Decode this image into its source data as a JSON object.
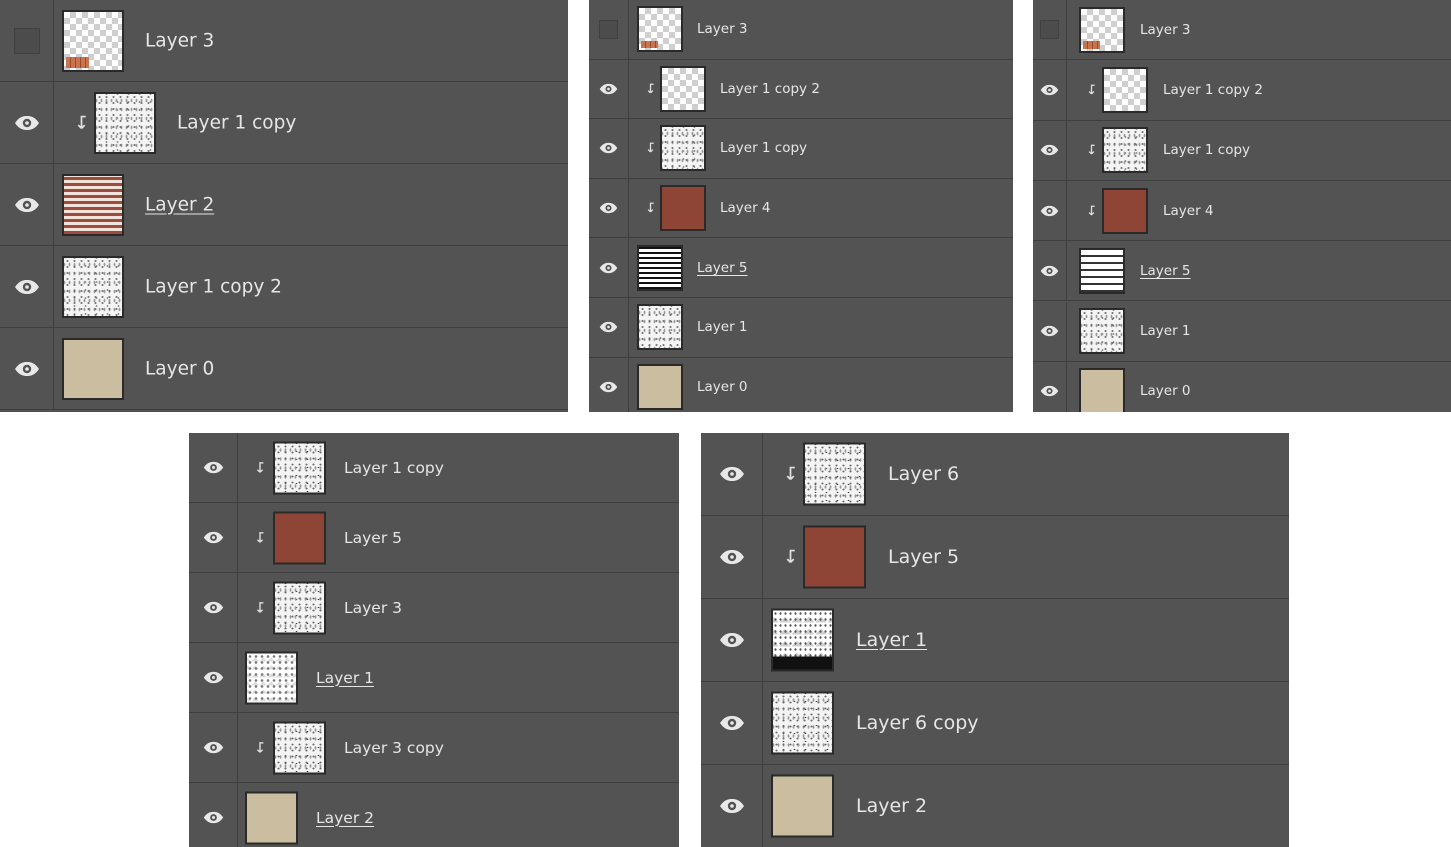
{
  "panels": [
    {
      "layers": [
        {
          "name": "Layer 3",
          "visible": false,
          "clipped": false,
          "thumb": "checker-brick",
          "underlined": false
        },
        {
          "name": "Layer 1 copy",
          "visible": true,
          "clipped": true,
          "thumb": "noise",
          "underlined": false
        },
        {
          "name": "Layer 2",
          "visible": true,
          "clipped": false,
          "thumb": "brick",
          "underlined": true
        },
        {
          "name": "Layer 1 copy 2",
          "visible": true,
          "clipped": false,
          "thumb": "noise",
          "underlined": false
        },
        {
          "name": "Layer 0",
          "visible": true,
          "clipped": false,
          "thumb": "tan",
          "underlined": false
        }
      ]
    },
    {
      "layers": [
        {
          "name": "Layer 3",
          "visible": false,
          "clipped": false,
          "thumb": "checker-brick",
          "underlined": false
        },
        {
          "name": "Layer 1 copy 2",
          "visible": true,
          "clipped": true,
          "thumb": "checker",
          "underlined": false
        },
        {
          "name": "Layer 1 copy",
          "visible": true,
          "clipped": true,
          "thumb": "noise",
          "underlined": false
        },
        {
          "name": "Layer 4",
          "visible": true,
          "clipped": true,
          "thumb": "red",
          "underlined": false
        },
        {
          "name": "Layer 5",
          "visible": true,
          "clipped": false,
          "thumb": "alpha",
          "underlined": true
        },
        {
          "name": "Layer 1",
          "visible": true,
          "clipped": false,
          "thumb": "noise",
          "underlined": false
        },
        {
          "name": "Layer 0",
          "visible": true,
          "clipped": false,
          "thumb": "tan",
          "underlined": false
        }
      ]
    },
    {
      "layers": [
        {
          "name": "Layer 3",
          "visible": false,
          "clipped": false,
          "thumb": "checker-brick",
          "underlined": false
        },
        {
          "name": "Layer 1 copy 2",
          "visible": true,
          "clipped": true,
          "thumb": "checker",
          "underlined": false
        },
        {
          "name": "Layer 1 copy",
          "visible": true,
          "clipped": true,
          "thumb": "noise",
          "underlined": false
        },
        {
          "name": "Layer 4",
          "visible": true,
          "clipped": true,
          "thumb": "red",
          "underlined": false
        },
        {
          "name": "Layer 5",
          "visible": true,
          "clipped": false,
          "thumb": "letters",
          "underlined": true
        },
        {
          "name": "Layer 1",
          "visible": true,
          "clipped": false,
          "thumb": "noise",
          "underlined": false
        },
        {
          "name": "Layer 0",
          "visible": true,
          "clipped": false,
          "thumb": "tan",
          "underlined": false
        }
      ]
    },
    {
      "layers": [
        {
          "name": "Layer 1 copy",
          "visible": true,
          "clipped": true,
          "thumb": "noise",
          "underlined": false
        },
        {
          "name": "Layer 5",
          "visible": true,
          "clipped": true,
          "thumb": "red",
          "underlined": false
        },
        {
          "name": "Layer 3",
          "visible": true,
          "clipped": true,
          "thumb": "noise",
          "underlined": false
        },
        {
          "name": "Layer 1",
          "visible": true,
          "clipped": false,
          "thumb": "dots",
          "underlined": true
        },
        {
          "name": "Layer 3 copy",
          "visible": true,
          "clipped": true,
          "thumb": "noise",
          "underlined": false
        },
        {
          "name": "Layer 2",
          "visible": true,
          "clipped": false,
          "thumb": "tan",
          "underlined": true
        }
      ]
    },
    {
      "layers": [
        {
          "name": "Layer 6",
          "visible": true,
          "clipped": true,
          "thumb": "noise",
          "underlined": false
        },
        {
          "name": "Layer 5",
          "visible": true,
          "clipped": true,
          "thumb": "red",
          "underlined": false
        },
        {
          "name": "Layer 1",
          "visible": true,
          "clipped": false,
          "thumb": "partial",
          "underlined": true
        },
        {
          "name": "Layer 6 copy",
          "visible": true,
          "clipped": false,
          "thumb": "noise",
          "underlined": false
        },
        {
          "name": "Layer 2",
          "visible": true,
          "clipped": false,
          "thumb": "tan",
          "underlined": false
        }
      ]
    }
  ],
  "colors": {
    "panel_bg": "#535353",
    "row_border": "#3e3e3e",
    "text": "#e6e6e6",
    "red_fill": "#8e4535",
    "tan_fill": "#cbbd9f"
  },
  "icons": {
    "visibility": "eye-icon",
    "clipping": "clipping-mask-arrow-icon"
  }
}
